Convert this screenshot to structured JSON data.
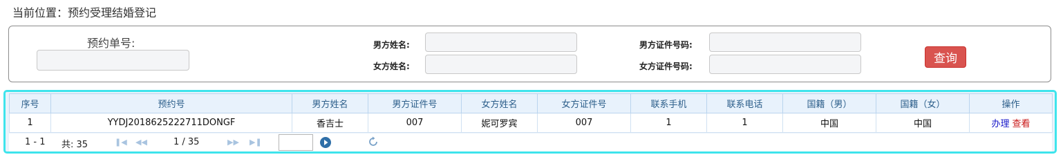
{
  "breadcrumb": {
    "text": "当前位置：预约受理结婚登记"
  },
  "search": {
    "booking_no_label": "预约单号:",
    "booking_no_value": "",
    "groom_name_label": "男方姓名:",
    "groom_name_value": "",
    "bride_name_label": "女方姓名:",
    "bride_name_value": "",
    "groom_id_label": "男方证件号码:",
    "groom_id_value": "",
    "bride_id_label": "女方证件号码:",
    "bride_id_value": "",
    "query_label": "查询"
  },
  "grid": {
    "columns": [
      "序号",
      "预约号",
      "男方姓名",
      "男方证件号",
      "女方姓名",
      "女方证件号",
      "联系手机",
      "联系电话",
      "国籍（男）",
      "国籍（女）",
      "操作"
    ],
    "rows": [
      {
        "index": "1",
        "booking_no": "YYDJ2018625222711DONGF",
        "groom_name": "香吉士",
        "groom_id": "007",
        "bride_name": "妮可罗宾",
        "bride_id": "007",
        "mobile": "1",
        "phone": "1",
        "groom_nationality": "中国",
        "bride_nationality": "中国",
        "action_handle": "办理",
        "action_view": "查看"
      }
    ]
  },
  "pager": {
    "range": "1 - 1",
    "total": "共: 35",
    "page_status": "1 / 35",
    "page_input": ""
  },
  "colors": {
    "query_button": "#d9534f",
    "grid_border": "#3ee4ec",
    "header_bg": "#e8f2fc",
    "action_handle": "#1515c8",
    "action_view": "#c81515"
  },
  "icons": {
    "first_page": "first-page-icon",
    "prev_page": "prev-page-icon",
    "next_page": "next-page-icon",
    "last_page": "last-page-icon",
    "go": "go-icon",
    "refresh": "refresh-icon"
  }
}
